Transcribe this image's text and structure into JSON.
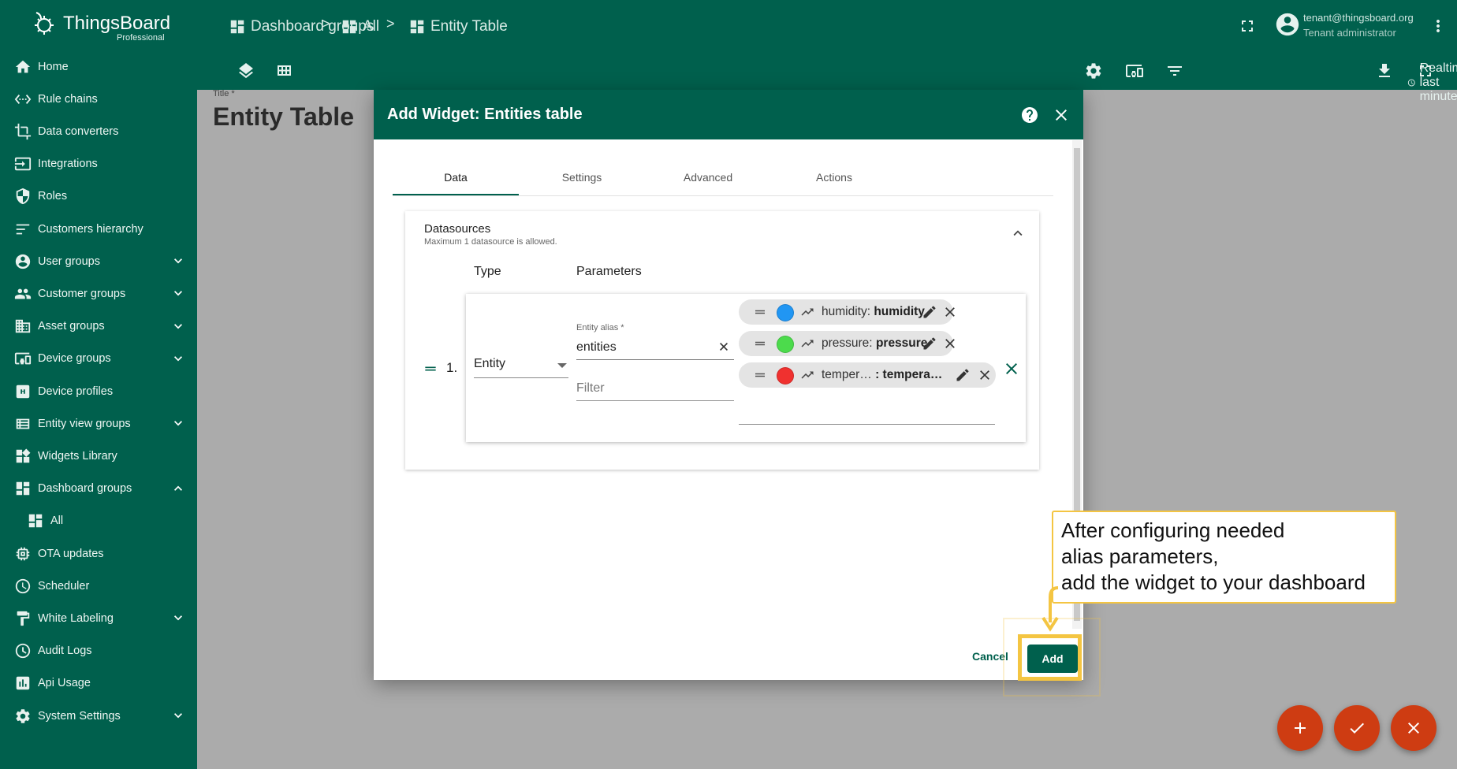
{
  "brand": {
    "name": "ThingsBoard",
    "edition": "Professional"
  },
  "sidebar": {
    "items": [
      {
        "label": "Home",
        "icon": "home-icon",
        "expandable": false
      },
      {
        "label": "Rule chains",
        "icon": "rule-chains-icon",
        "expandable": false
      },
      {
        "label": "Data converters",
        "icon": "data-converters-icon",
        "expandable": false
      },
      {
        "label": "Integrations",
        "icon": "integrations-icon",
        "expandable": false
      },
      {
        "label": "Roles",
        "icon": "roles-icon",
        "expandable": false
      },
      {
        "label": "Customers hierarchy",
        "icon": "hierarchy-icon",
        "expandable": false
      },
      {
        "label": "User groups",
        "icon": "user-groups-icon",
        "expandable": true
      },
      {
        "label": "Customer groups",
        "icon": "customer-groups-icon",
        "expandable": true
      },
      {
        "label": "Asset groups",
        "icon": "asset-groups-icon",
        "expandable": true
      },
      {
        "label": "Device groups",
        "icon": "device-groups-icon",
        "expandable": true
      },
      {
        "label": "Device profiles",
        "icon": "device-profiles-icon",
        "expandable": false
      },
      {
        "label": "Entity view groups",
        "icon": "entity-view-groups-icon",
        "expandable": true
      },
      {
        "label": "Widgets Library",
        "icon": "widgets-library-icon",
        "expandable": false
      },
      {
        "label": "Dashboard groups",
        "icon": "dashboard-groups-icon",
        "expandable": true,
        "expanded": true
      },
      {
        "label": "All",
        "icon": "dashboard-icon",
        "expandable": false,
        "sub": true
      },
      {
        "label": "OTA updates",
        "icon": "ota-updates-icon",
        "expandable": false
      },
      {
        "label": "Scheduler",
        "icon": "scheduler-icon",
        "expandable": false
      },
      {
        "label": "White Labeling",
        "icon": "white-labeling-icon",
        "expandable": true
      },
      {
        "label": "Audit Logs",
        "icon": "audit-logs-icon",
        "expandable": false
      },
      {
        "label": "Api Usage",
        "icon": "api-usage-icon",
        "expandable": false
      },
      {
        "label": "System Settings",
        "icon": "settings-icon",
        "expandable": true
      }
    ]
  },
  "breadcrumb": {
    "items": [
      "Dashboard groups",
      "All",
      "Entity Table"
    ],
    "separator": ">"
  },
  "user": {
    "email": "tenant@thingsboard.org",
    "role": "Tenant administrator"
  },
  "toolbar": {
    "timewindow": "Realtime - last minute"
  },
  "dashboard": {
    "title_label": "Title *",
    "title": "Entity Table"
  },
  "dialog": {
    "title": "Add Widget: Entities table",
    "tabs": [
      "Data",
      "Settings",
      "Advanced",
      "Actions"
    ],
    "active_tab": "Data",
    "datasources": {
      "title": "Datasources",
      "subtitle": "Maximum 1 datasource is allowed.",
      "col_type": "Type",
      "col_params": "Parameters",
      "row": {
        "index": "1.",
        "type": "Entity",
        "alias_label": "Entity alias *",
        "alias_value": "entities",
        "filter_placeholder": "Filter",
        "keys": [
          {
            "label": "humidity:",
            "name": "humidity",
            "color": "#2196f3"
          },
          {
            "label": "pressure:",
            "name": "pressure",
            "color": "#4cdb4c"
          },
          {
            "label": "temper…",
            "name": ": tempera…",
            "color": "#f0312f"
          }
        ]
      }
    },
    "cancel_label": "Cancel",
    "add_label": "Add"
  },
  "callout": {
    "lines": [
      "After configuring needed",
      "alias parameters,",
      "add the widget to your dashboard"
    ],
    "color": "#f4c542"
  },
  "colors": {
    "primary": "#00604d",
    "fab": "#ce3c12",
    "highlight": "#f4c542"
  }
}
